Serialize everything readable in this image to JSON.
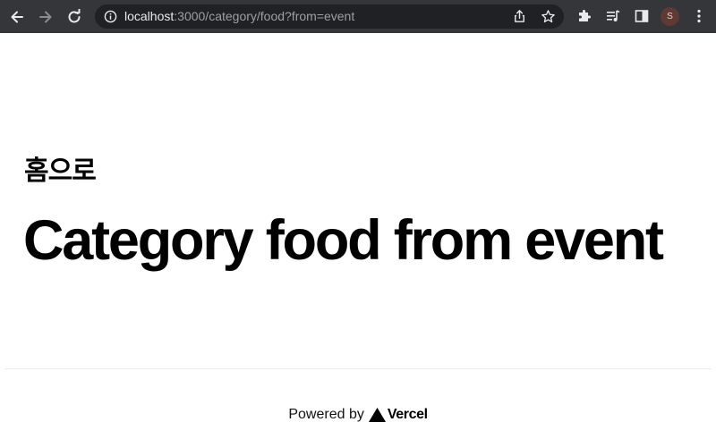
{
  "browser": {
    "url_host": "localhost",
    "url_rest": ":3000/category/food?from=event",
    "profile_initial": "S"
  },
  "page": {
    "home_link": "홈으로",
    "title": "Category food from event"
  },
  "footer": {
    "powered_by": "Powered by",
    "brand": "Vercel"
  }
}
